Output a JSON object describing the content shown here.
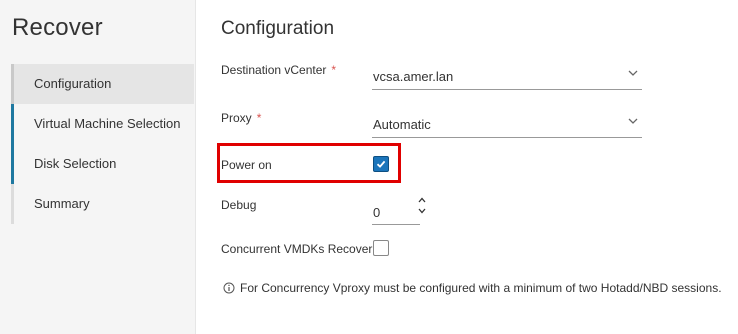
{
  "sidebar": {
    "title": "Recover",
    "items": [
      {
        "label": "Configuration"
      },
      {
        "label": "Virtual Machine Selection"
      },
      {
        "label": "Disk Selection"
      },
      {
        "label": "Summary"
      }
    ]
  },
  "main": {
    "section_title": "Configuration",
    "destination_vcenter": {
      "label": "Destination vCenter",
      "required": "*",
      "value": "vcsa.amer.lan"
    },
    "proxy": {
      "label": "Proxy",
      "required": "*",
      "value": "Automatic"
    },
    "power_on": {
      "label": "Power on",
      "checked": true
    },
    "debug": {
      "label": "Debug",
      "value": "0"
    },
    "concurrent": {
      "label": "Concurrent VMDKs Recover",
      "checked": false
    },
    "info_text": "For Concurrency Vproxy must be configured with a minimum of two Hotadd/NBD sessions."
  },
  "colors": {
    "accent": "#1b75bb",
    "highlight": "#e00000",
    "required": "#d9534f"
  }
}
